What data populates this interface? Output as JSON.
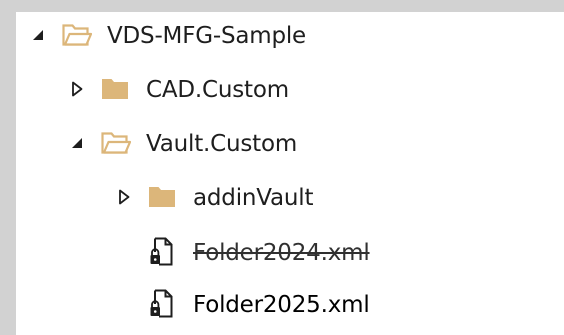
{
  "tree": {
    "nodes": [
      {
        "label": "VDS-MFG-Sample",
        "state": "expanded",
        "icon": "folder-open-icon",
        "depth": 0
      },
      {
        "label": "CAD.Custom",
        "state": "collapsed",
        "icon": "folder-closed-icon",
        "depth": 1
      },
      {
        "label": "Vault.Custom",
        "state": "expanded",
        "icon": "folder-open-icon",
        "depth": 1
      },
      {
        "label": "addinVault",
        "state": "collapsed",
        "icon": "folder-closed-icon",
        "depth": 2
      },
      {
        "label": "Folder2024.xml",
        "state": "leaf",
        "icon": "xml-file-locked-icon",
        "depth": 2,
        "strikethrough": true
      },
      {
        "label": "Folder2025.xml",
        "state": "leaf",
        "icon": "xml-file-locked-icon",
        "depth": 2,
        "strikethrough": false
      }
    ]
  },
  "colors": {
    "folder": "#dcb67a",
    "folder_dark": "#c79a4e",
    "arrow": "#1e1e1e",
    "background": "#d2d2d2",
    "panel": "#ffffff"
  }
}
